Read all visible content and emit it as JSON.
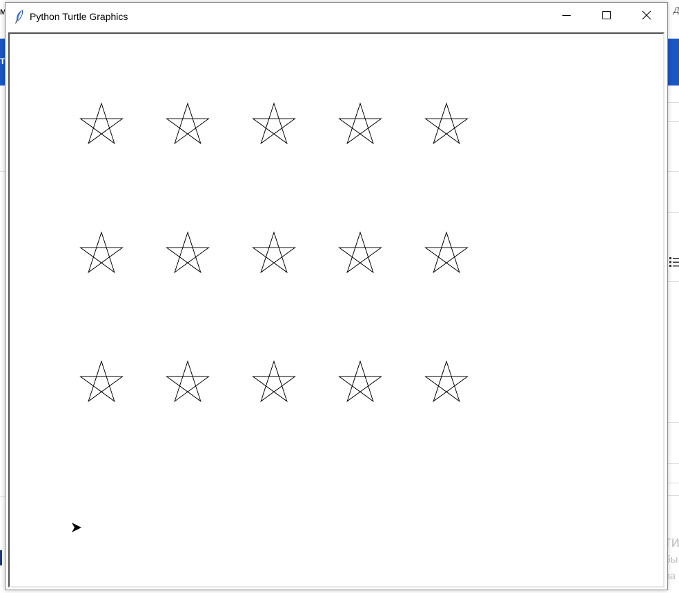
{
  "window": {
    "title": "Python Turtle Graphics",
    "app_icon": "feather-icon",
    "controls": {
      "minimize_icon": "minimize-icon",
      "maximize_icon": "maximize-icon",
      "close_icon": "close-icon"
    }
  },
  "canvas": {
    "background": "#ffffff",
    "stroke_color": "#000000",
    "star_grid": {
      "rows": 3,
      "columns": 5,
      "shape": "five-point-star"
    },
    "turtle": {
      "shape": "arrow",
      "heading": "east",
      "color": "#000000"
    }
  },
  "background": {
    "top_left_fragment": "M",
    "top_right_fragment": "Д",
    "blue_band_letter": "T",
    "accent_color": "#1a56c4",
    "list_icon": "list-icon",
    "watermark": {
      "title": "Акти",
      "line1": "Чтобы",
      "line2": "\"Пара"
    }
  }
}
